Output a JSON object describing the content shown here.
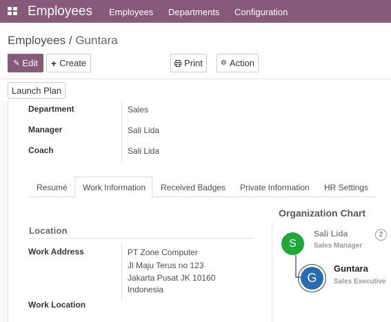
{
  "navbar": {
    "app_title": "Employees",
    "menu": [
      "Employees",
      "Departments",
      "Configuration"
    ]
  },
  "breadcrumb": {
    "parent": "Employees",
    "separator": "/",
    "current": "Guntara"
  },
  "toolbar": {
    "edit_label": "Edit",
    "create_label": "Create",
    "print_label": "Print",
    "action_label": "Action",
    "launch_plan_label": "Launch Plan"
  },
  "fields": {
    "department_label": "Department",
    "department_value": "Sales",
    "manager_label": "Manager",
    "manager_value": "Sali Lida",
    "coach_label": "Coach",
    "coach_value": "Sali Lida"
  },
  "tabs": [
    "Resumé",
    "Work Information",
    "Received Badges",
    "Private Information",
    "HR Settings"
  ],
  "active_tab": "Work Information",
  "location": {
    "section_title": "Location",
    "work_address_label": "Work Address",
    "address_lines": [
      "PT Zone Computer",
      "Jl Maju Terus no 123",
      "Jakarta Pusat JK 10160",
      "Indonesia"
    ],
    "work_location_label": "Work Location"
  },
  "org_chart": {
    "title": "Organization Chart",
    "manager": {
      "initial": "S",
      "name": "Sali Lida",
      "job": "Sales Manager",
      "subordinates": "2",
      "color": "#1fa93b"
    },
    "employee": {
      "initial": "G",
      "name": "Guntara",
      "job": "Sales Executive",
      "color": "#2a6bb0"
    }
  }
}
